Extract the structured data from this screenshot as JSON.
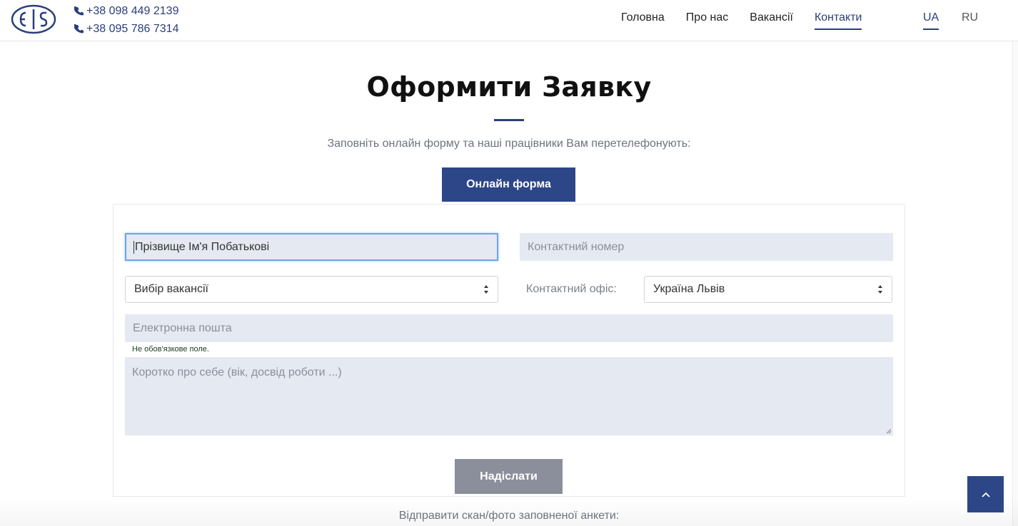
{
  "header": {
    "logo_icon": "eis-logo",
    "phones": [
      "+38 098 449 2139",
      "+38 095 786 7314"
    ],
    "phone_icon": "phone-icon",
    "nav": [
      {
        "label": "Головна",
        "active": false
      },
      {
        "label": "Про нас",
        "active": false
      },
      {
        "label": "Вакансії",
        "active": false
      },
      {
        "label": "Контакти",
        "active": true
      }
    ],
    "languages": [
      {
        "label": "UA",
        "active": true
      },
      {
        "label": "RU",
        "active": false
      }
    ]
  },
  "section": {
    "title": "Оформити Заявку",
    "subtitle": "Заповніть онлайн форму та наші працівники Вам перетелефонують:",
    "online_button": "Онлайн форма"
  },
  "form": {
    "name_placeholder": "Прізвище Ім'я Побатькові",
    "phone_placeholder": "Контактний номер",
    "vacancy_select": "Вибір вакансії",
    "office_label": "Контактний офіс:",
    "office_select": "Україна Львів",
    "email_placeholder": "Електронна пошта",
    "email_hint": "Не обов'язкове поле.",
    "about_placeholder": "Коротко про себе (вік, досвід роботи ...)",
    "submit_label": "Надіслати"
  },
  "footer": {
    "scan_text": "Відправити скан/фото заповненої анкети:"
  },
  "colors": {
    "brand": "#2c4688",
    "field_bg": "#e5e9f2",
    "submit_bg": "#8b8f9c"
  },
  "scroll_top_icon": "chevron-up-icon"
}
